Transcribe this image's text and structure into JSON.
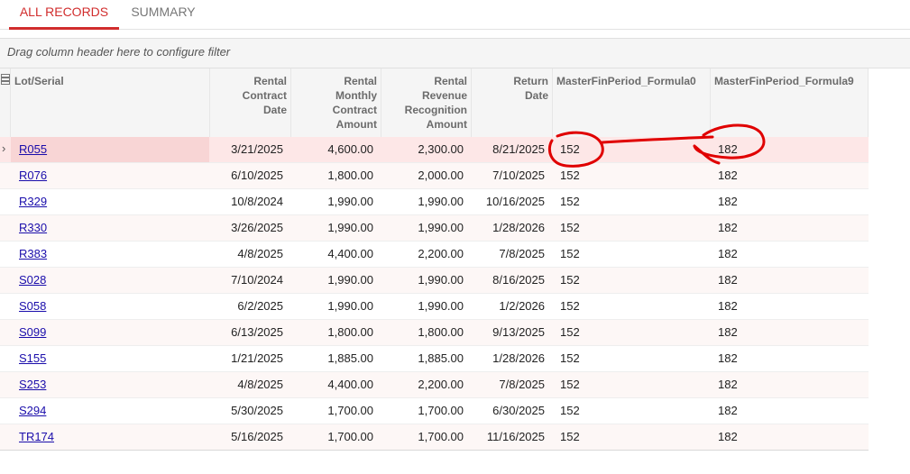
{
  "tabs": [
    {
      "label": "ALL RECORDS"
    },
    {
      "label": "SUMMARY"
    }
  ],
  "filter": {
    "placeholder": "Drag column header here to configure filter"
  },
  "columns": [
    {
      "line1": "Lot/Serial",
      "line2": "",
      "line3": "",
      "line4": ""
    },
    {
      "line1": "Rental",
      "line2": "Contract",
      "line3": "Date",
      "line4": ""
    },
    {
      "line1": "Rental",
      "line2": "Monthly",
      "line3": "Contract",
      "line4": "Amount"
    },
    {
      "line1": "Rental",
      "line2": "Revenue",
      "line3": "Recognition",
      "line4": "Amount"
    },
    {
      "line1": "Return",
      "line2": "Date",
      "line3": "",
      "line4": ""
    },
    {
      "line1": "MasterFinPeriod_Formula0",
      "line2": "",
      "line3": "",
      "line4": ""
    },
    {
      "line1": "MasterFinPeriod_Formula9",
      "line2": "",
      "line3": "",
      "line4": ""
    }
  ],
  "rows": [
    {
      "lot": "R055",
      "contract_date": "3/21/2025",
      "monthly": "4,600.00",
      "revenue": "2,300.00",
      "return_date": "8/21/2025",
      "period_a": "152",
      "period_b": "182"
    },
    {
      "lot": "R076",
      "contract_date": "6/10/2025",
      "monthly": "1,800.00",
      "revenue": "2,000.00",
      "return_date": "7/10/2025",
      "period_a": "152",
      "period_b": "182"
    },
    {
      "lot": "R329",
      "contract_date": "10/8/2024",
      "monthly": "1,990.00",
      "revenue": "1,990.00",
      "return_date": "10/16/2025",
      "period_a": "152",
      "period_b": "182"
    },
    {
      "lot": "R330",
      "contract_date": "3/26/2025",
      "monthly": "1,990.00",
      "revenue": "1,990.00",
      "return_date": "1/28/2026",
      "period_a": "152",
      "period_b": "182"
    },
    {
      "lot": "R383",
      "contract_date": "4/8/2025",
      "monthly": "4,400.00",
      "revenue": "2,200.00",
      "return_date": "7/8/2025",
      "period_a": "152",
      "period_b": "182"
    },
    {
      "lot": "S028",
      "contract_date": "7/10/2024",
      "monthly": "1,990.00",
      "revenue": "1,990.00",
      "return_date": "8/16/2025",
      "period_a": "152",
      "period_b": "182"
    },
    {
      "lot": "S058",
      "contract_date": "6/2/2025",
      "monthly": "1,990.00",
      "revenue": "1,990.00",
      "return_date": "1/2/2026",
      "period_a": "152",
      "period_b": "182"
    },
    {
      "lot": "S099",
      "contract_date": "6/13/2025",
      "monthly": "1,800.00",
      "revenue": "1,800.00",
      "return_date": "9/13/2025",
      "period_a": "152",
      "period_b": "182"
    },
    {
      "lot": "S155",
      "contract_date": "1/21/2025",
      "monthly": "1,885.00",
      "revenue": "1,885.00",
      "return_date": "1/28/2026",
      "period_a": "152",
      "period_b": "182"
    },
    {
      "lot": "S253",
      "contract_date": "4/8/2025",
      "monthly": "4,400.00",
      "revenue": "2,200.00",
      "return_date": "7/8/2025",
      "period_a": "152",
      "period_b": "182"
    },
    {
      "lot": "S294",
      "contract_date": "5/30/2025",
      "monthly": "1,700.00",
      "revenue": "1,700.00",
      "return_date": "6/30/2025",
      "period_a": "152",
      "period_b": "182"
    },
    {
      "lot": "TR174",
      "contract_date": "5/16/2025",
      "monthly": "1,700.00",
      "revenue": "1,700.00",
      "return_date": "11/16/2025",
      "period_a": "152",
      "period_b": "182"
    }
  ],
  "icons": {
    "settings": "grid-settings-icon",
    "row_pointer": "chevron-right-icon"
  },
  "colors": {
    "accent": "#d12d2d",
    "link": "#1a0dab",
    "selected_row": "#fde7e7",
    "annotation": "#e00000"
  }
}
